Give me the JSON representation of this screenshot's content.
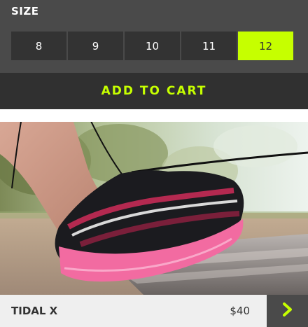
{
  "size_selector": {
    "title": "SIZE",
    "options": [
      "8",
      "9",
      "10",
      "11",
      "12"
    ],
    "selected": "12",
    "accent_color": "#c6ff00"
  },
  "cart": {
    "button_label": "ADD TO CART"
  },
  "product": {
    "image_icon": "running-shoe-photo",
    "name": "TIDAL X",
    "price": "$40",
    "next_icon": "chevron-right-icon"
  }
}
